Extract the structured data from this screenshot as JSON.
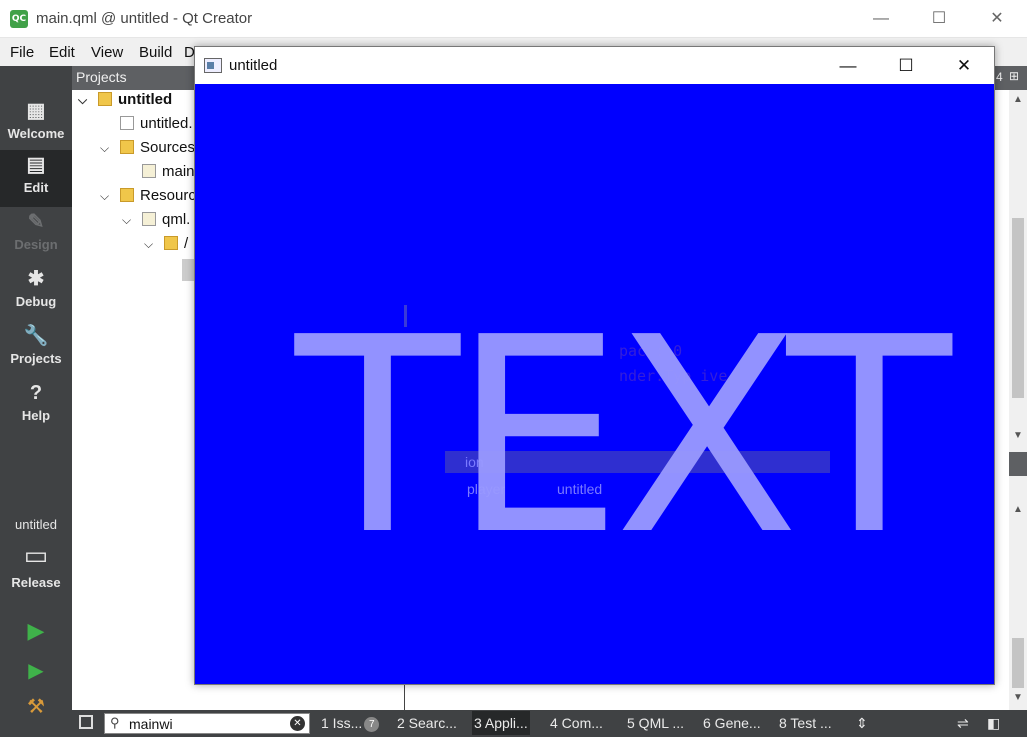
{
  "window": {
    "title": "main.qml @ untitled - Qt Creator",
    "logo": "QC",
    "minimize_glyph": "—",
    "maximize_glyph": "☐",
    "close_glyph": "✕"
  },
  "menubar": {
    "items": [
      "File",
      "Edit",
      "View",
      "Build",
      "D"
    ]
  },
  "modes": [
    {
      "label": "Welcome",
      "icon": "grid-icon",
      "glyph": "▦"
    },
    {
      "label": "Edit",
      "icon": "document-icon",
      "glyph": "▤"
    },
    {
      "label": "Design",
      "icon": "pencil-icon",
      "glyph": "✎"
    },
    {
      "label": "Debug",
      "icon": "bug-icon",
      "glyph": "✱"
    },
    {
      "label": "Projects",
      "icon": "wrench-icon",
      "glyph": "🔧"
    },
    {
      "label": "Help",
      "icon": "help-icon",
      "glyph": "?"
    }
  ],
  "kit": {
    "project": "untitled",
    "build": "Release"
  },
  "projects_pane": {
    "title": "Projects",
    "tree": [
      "untitled",
      "untitled.",
      "Sources",
      "main",
      "Resourc",
      "qml.",
      "/"
    ]
  },
  "app_window": {
    "title": "untitled",
    "canvas_color": "#0000ff",
    "text": "TEXT"
  },
  "ghost_editor": {
    "line1": "pac  : 0",
    "line2": "nder.Typ        ive",
    "tab1": "ion",
    "tab2": "player",
    "tab3": "untitled"
  },
  "right_pane": {
    "label": "4"
  },
  "statusbar": {
    "locator_value": "mainwi",
    "tabs": [
      {
        "label": "1  Iss...",
        "badge": "7"
      },
      {
        "label": "2  Searc..."
      },
      {
        "label": "3  Appli..."
      },
      {
        "label": "4  Com..."
      },
      {
        "label": "5  QML ..."
      },
      {
        "label": "6  Gene..."
      },
      {
        "label": "8  Test ..."
      }
    ]
  },
  "colors": {
    "modebar": "#404244",
    "active_mode": "#262829",
    "canvas": "#0000ff",
    "text": "#9a9aff"
  }
}
